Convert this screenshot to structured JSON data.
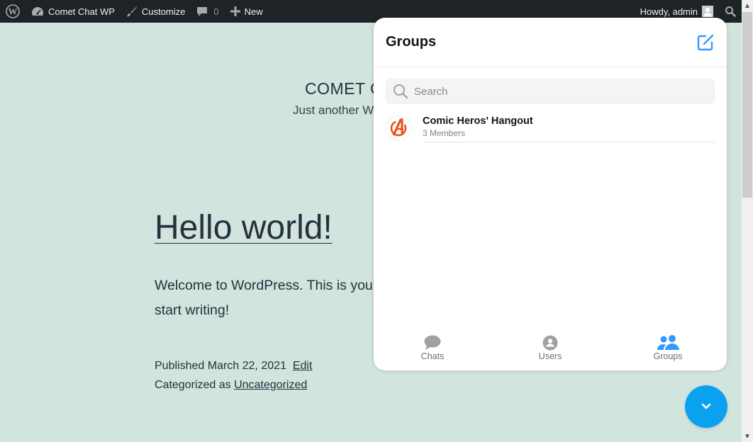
{
  "adminbar": {
    "site_name": "Comet Chat WP",
    "customize_label": "Customize",
    "comments_count": "0",
    "new_label": "New",
    "greeting": "Howdy, admin"
  },
  "page": {
    "site_title": "COMET C",
    "site_description": "Just another W",
    "post_title": "Hello world!",
    "post_body": "Welcome to WordPress. This is you start writing!",
    "published_label": "Published",
    "published_date": "March 22, 2021",
    "edit_label": "Edit",
    "categorized_label": "Categorized as",
    "category": "Uncategorized"
  },
  "chat": {
    "title": "Groups",
    "search_placeholder": "Search",
    "groups": [
      {
        "name": "Comic Heros' Hangout",
        "members": "3 Members"
      }
    ],
    "tabs": [
      {
        "label": "Chats",
        "icon": "chat-bubble-icon",
        "active": false
      },
      {
        "label": "Users",
        "icon": "user-circle-icon",
        "active": false
      },
      {
        "label": "Groups",
        "icon": "groups-icon",
        "active": true
      }
    ],
    "colors": {
      "accent": "#3399ff",
      "fab": "#0aa2ef",
      "inactive_icon": "#a0a0a0",
      "group_avatar": "#e8501e"
    }
  }
}
